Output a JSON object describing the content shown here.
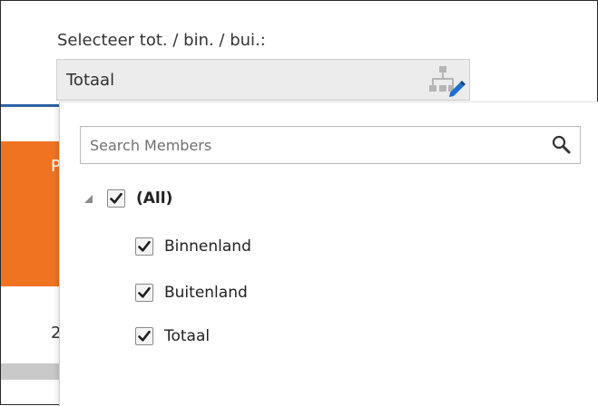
{
  "selector": {
    "label": "Selecteer tot. / bin. / bui.:",
    "value": "Totaal"
  },
  "background": {
    "orange_fragment": "P",
    "row_fragment": "2"
  },
  "dropdown": {
    "search_placeholder": "Search Members",
    "tree": {
      "root": {
        "label": "(All)",
        "checked": true,
        "expanded": true
      },
      "children": [
        {
          "label": "Binnenland",
          "checked": true
        },
        {
          "label": "Buitenland",
          "checked": true
        },
        {
          "label": "Totaal",
          "checked": true
        }
      ]
    }
  },
  "colors": {
    "accent_orange": "#f07322",
    "accent_blue": "#2e63a5",
    "selector_bg": "#ececec"
  },
  "icons": {
    "hierarchy": "hierarchy-edit-icon",
    "search": "search-icon",
    "expander": "triangle-expanded-icon",
    "check": "checkmark-icon"
  }
}
